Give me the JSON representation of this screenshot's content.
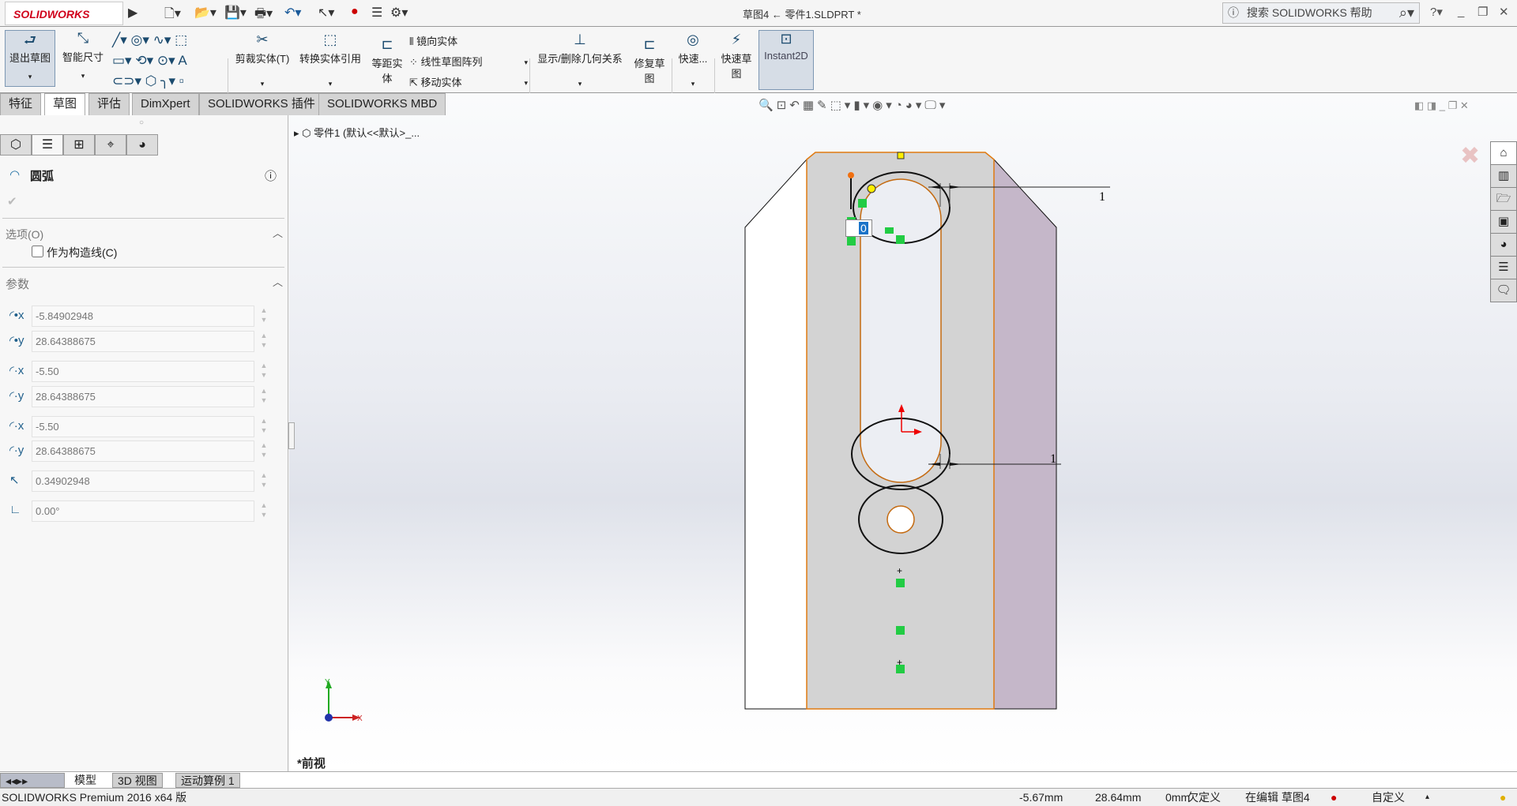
{
  "app": {
    "logo": "SOLIDWORKS",
    "title": "草图4 ← 零件1.SLDPRT *",
    "search_placeholder": "搜索 SOLIDWORKS 帮助"
  },
  "quick_access": [
    "new-icon",
    "open-icon",
    "save-icon",
    "print-icon",
    "undo-icon",
    "select-icon",
    "rebuild-icon",
    "options-icon",
    "settings-icon"
  ],
  "ribbon": {
    "exit_sketch": "退出草图",
    "smart_dim": "智能尺寸",
    "trim": "剪裁实体(T)",
    "convert": "转换实体引用",
    "offset": "等距实体",
    "mirror": "镜向实体",
    "linear_pattern": "线性草图阵列",
    "move": "移动实体",
    "relations": "显示/删除几何关系",
    "repair": "修复草图",
    "quick_snap": "快速...",
    "rapid_sketch": "快速草图",
    "instant2d": "Instant2D"
  },
  "tabs": [
    {
      "label": "特征"
    },
    {
      "label": "草图",
      "active": true
    },
    {
      "label": "评估"
    },
    {
      "label": "DimXpert"
    },
    {
      "label": "SOLIDWORKS 插件"
    },
    {
      "label": "SOLIDWORKS MBD"
    }
  ],
  "tree": {
    "label": "零件1 (默认<<默认>_..."
  },
  "panel": {
    "title": "圆弧",
    "options_header": "选项(O)",
    "construction_label": "作为构造线(C)",
    "construction_checked": false,
    "params_header": "参数",
    "params": [
      {
        "icon": "center-x-icon",
        "value": "-5.84902948"
      },
      {
        "icon": "center-y-icon",
        "value": "28.64388675"
      },
      {
        "icon": "start-x-icon",
        "value": "-5.50"
      },
      {
        "icon": "start-y-icon",
        "value": "28.64388675"
      },
      {
        "icon": "end-x-icon",
        "value": "-5.50"
      },
      {
        "icon": "end-y-icon",
        "value": "28.64388675"
      },
      {
        "icon": "radius-icon",
        "value": "0.34902948"
      },
      {
        "icon": "angle-icon",
        "value": "0.00°"
      }
    ]
  },
  "viewport": {
    "view_name": "*前视",
    "dim_top": "1",
    "dim_bottom": "1",
    "input_value": "0",
    "triad_x": "X",
    "triad_y": "Y"
  },
  "bottom_tabs": [
    {
      "label": "模型",
      "active": true
    },
    {
      "label": "3D 视图"
    },
    {
      "label": "运动算例 1"
    }
  ],
  "status": {
    "product": "SOLIDWORKS Premium 2016 x64 版",
    "x": "-5.67mm",
    "y": "28.64mm",
    "z": "0mm",
    "define": "欠定义",
    "editing": "在编辑 草图4",
    "units": "自定义"
  },
  "colors": {
    "sketch_orange": "#e07a10",
    "face_gray": "#d3d3d3",
    "face_purple": "#c5b7c9",
    "relation_green": "#22cc44"
  }
}
